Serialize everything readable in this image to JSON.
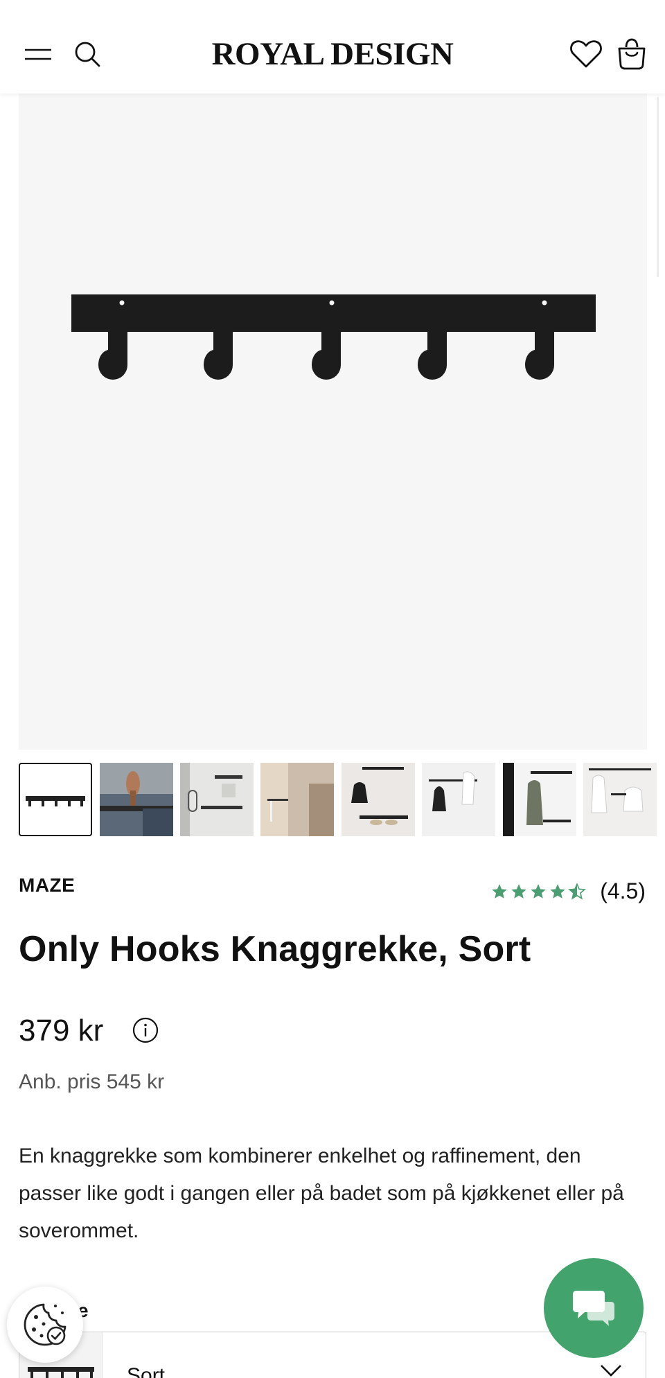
{
  "header": {
    "logo": "ROYAL DESIGN",
    "icons": [
      "menu-icon",
      "search-icon",
      "heart-icon",
      "bag-icon"
    ]
  },
  "gallery": {
    "thumbnail_count": 8,
    "active_index": 0
  },
  "product": {
    "brand": "MAZE",
    "rating_value": "(4.5)",
    "rating_stars": 4.5,
    "title": "Only Hooks Knaggrekke, Sort",
    "price": "379 kr",
    "recommended_price": "Anb. pris 545 kr",
    "description": "En knaggrekke som kombinerer enkelhet og raffinement, den passer like godt i gangen eller på badet som på kjøkkenet eller på soverommet.",
    "color_label": "rge",
    "color_value": "Sort"
  },
  "colors": {
    "star": "#4a9e72",
    "chat": "#43a36c",
    "product_black": "#1c1c1c"
  }
}
